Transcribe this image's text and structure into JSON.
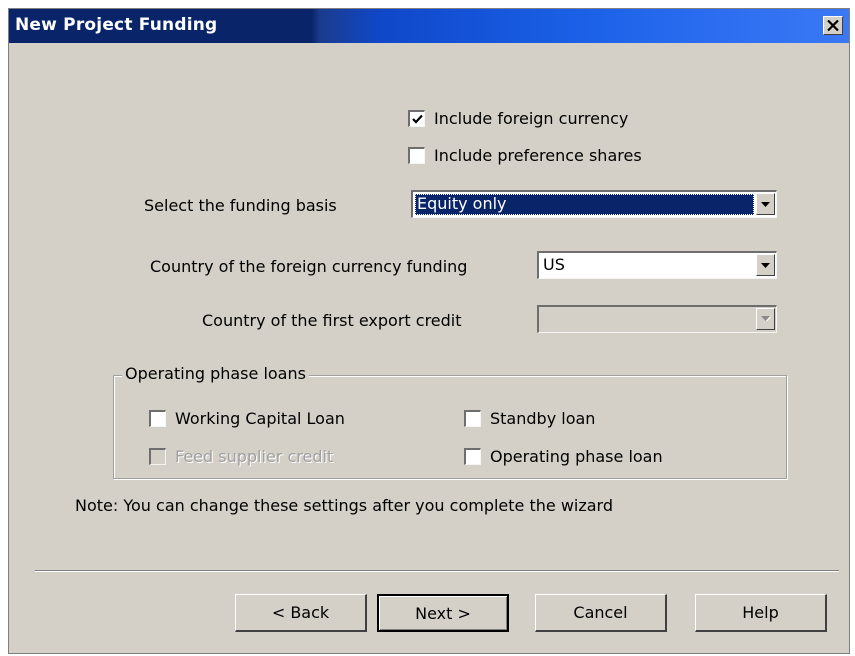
{
  "window": {
    "title": "New Project Funding"
  },
  "options": {
    "include_foreign_currency": {
      "label": "Include foreign currency",
      "checked": true
    },
    "include_preference_shares": {
      "label": "Include preference shares",
      "checked": false
    }
  },
  "funding_basis": {
    "label": "Select the funding basis",
    "value": "Equity only"
  },
  "foreign_currency_country": {
    "label": "Country of the foreign currency funding",
    "value": "US"
  },
  "export_credit_country": {
    "label": "Country of the first export credit",
    "value": "",
    "enabled": false
  },
  "operating_loans": {
    "title": "Operating phase loans",
    "working_capital_loan": {
      "label": "Working Capital Loan",
      "checked": false
    },
    "standby_loan": {
      "label": "Standby loan",
      "checked": false
    },
    "feed_supplier_credit": {
      "label": "Feed supplier credit",
      "checked": false,
      "enabled": false
    },
    "operating_phase_loan": {
      "label": "Operating phase loan",
      "checked": false
    }
  },
  "note": "Note: You can change these settings after you complete the wizard",
  "buttons": {
    "back": "< Back",
    "next": "Next >",
    "cancel": "Cancel",
    "help": "Help"
  },
  "colors": {
    "title_bar": "#0a246a",
    "window_face": "#d4d0c8",
    "selection": "#0a246a"
  }
}
